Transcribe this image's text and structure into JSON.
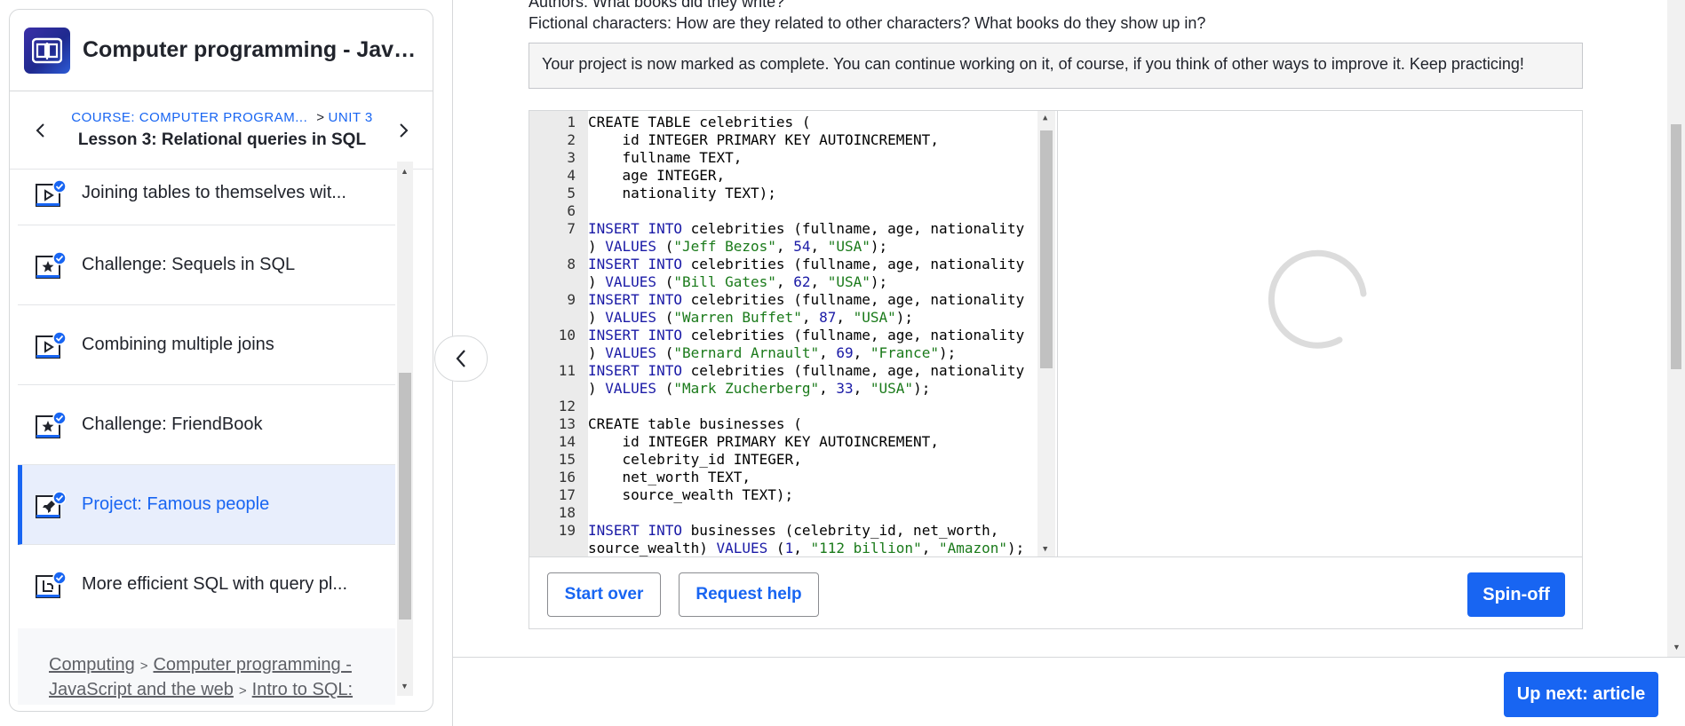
{
  "sidebar": {
    "course_title": "Computer programming - JavaScript and the web",
    "course_crumb": "COURSE: COMPUTER PROGRAM...",
    "unit_crumb": "UNIT 3",
    "lesson_title": "Lesson 3: Relational queries in SQL",
    "items": [
      {
        "label": "Joining tables to themselves wit...",
        "type": "video",
        "done": true
      },
      {
        "label": "Challenge: Sequels in SQL",
        "type": "challenge",
        "done": true
      },
      {
        "label": "Combining multiple joins",
        "type": "video",
        "done": true
      },
      {
        "label": "Challenge: FriendBook",
        "type": "challenge",
        "done": true
      },
      {
        "label": "Project: Famous people",
        "type": "project",
        "done": true,
        "active": true
      },
      {
        "label": "More efficient SQL with query pl...",
        "type": "article",
        "done": true
      }
    ],
    "breadcrumb": {
      "computing": "Computing",
      "course": "Computer programming - JavaScript and the web",
      "unit": "Intro to SQL:"
    }
  },
  "main": {
    "desc_line1": "Authors: What books did they write?",
    "desc_line2": "Fictional characters: How are they related to other characters? What books do they show up in?",
    "complete_message": "Your project is now marked as complete. You can continue working on it, of course, if you think of other ways to improve it. Keep practicing!",
    "code_lines": [
      {
        "n": "1",
        "c": "CREATE TABLE celebrities ("
      },
      {
        "n": "2",
        "c": "    id INTEGER PRIMARY KEY AUTOINCREMENT,"
      },
      {
        "n": "3",
        "c": "    fullname TEXT,"
      },
      {
        "n": "4",
        "c": "    age INTEGER,"
      },
      {
        "n": "5",
        "c": "    nationality TEXT);"
      },
      {
        "n": "6",
        "c": ""
      },
      {
        "n": "7",
        "c": "INSERT INTO celebrities (fullname, age, nationality"
      },
      {
        "n": "",
        "c": ") VALUES (\"Jeff Bezos\", 54, \"USA\");"
      },
      {
        "n": "8",
        "c": "INSERT INTO celebrities (fullname, age, nationality"
      },
      {
        "n": "",
        "c": ") VALUES (\"Bill Gates\", 62, \"USA\");"
      },
      {
        "n": "9",
        "c": "INSERT INTO celebrities (fullname, age, nationality"
      },
      {
        "n": "",
        "c": ") VALUES (\"Warren Buffet\", 87, \"USA\");"
      },
      {
        "n": "10",
        "c": "INSERT INTO celebrities (fullname, age, nationality"
      },
      {
        "n": "",
        "c": ") VALUES (\"Bernard Arnault\", 69, \"France\");"
      },
      {
        "n": "11",
        "c": "INSERT INTO celebrities (fullname, age, nationality"
      },
      {
        "n": "",
        "c": ") VALUES (\"Mark Zucherberg\", 33, \"USA\");"
      },
      {
        "n": "12",
        "c": ""
      },
      {
        "n": "13",
        "c": "CREATE table businesses ("
      },
      {
        "n": "14",
        "c": "    id INTEGER PRIMARY KEY AUTOINCREMENT,"
      },
      {
        "n": "15",
        "c": "    celebrity_id INTEGER,"
      },
      {
        "n": "16",
        "c": "    net_worth TEXT,"
      },
      {
        "n": "17",
        "c": "    source_wealth TEXT);"
      },
      {
        "n": "18",
        "c": ""
      },
      {
        "n": "19",
        "c": "INSERT INTO businesses (celebrity_id, net_worth,"
      },
      {
        "n": "",
        "c": "source_wealth) VALUES (1, \"112 billion\", \"Amazon\");"
      }
    ],
    "start_over_label": "Start over",
    "request_help_label": "Request help",
    "spinoff_label": "Spin-off",
    "up_next_label": "Up next: article"
  },
  "colors": {
    "accent": "#1865f2",
    "active_bg": "#e8eefc",
    "keyword": "#1a1aa6",
    "string": "#1a7a1a"
  }
}
